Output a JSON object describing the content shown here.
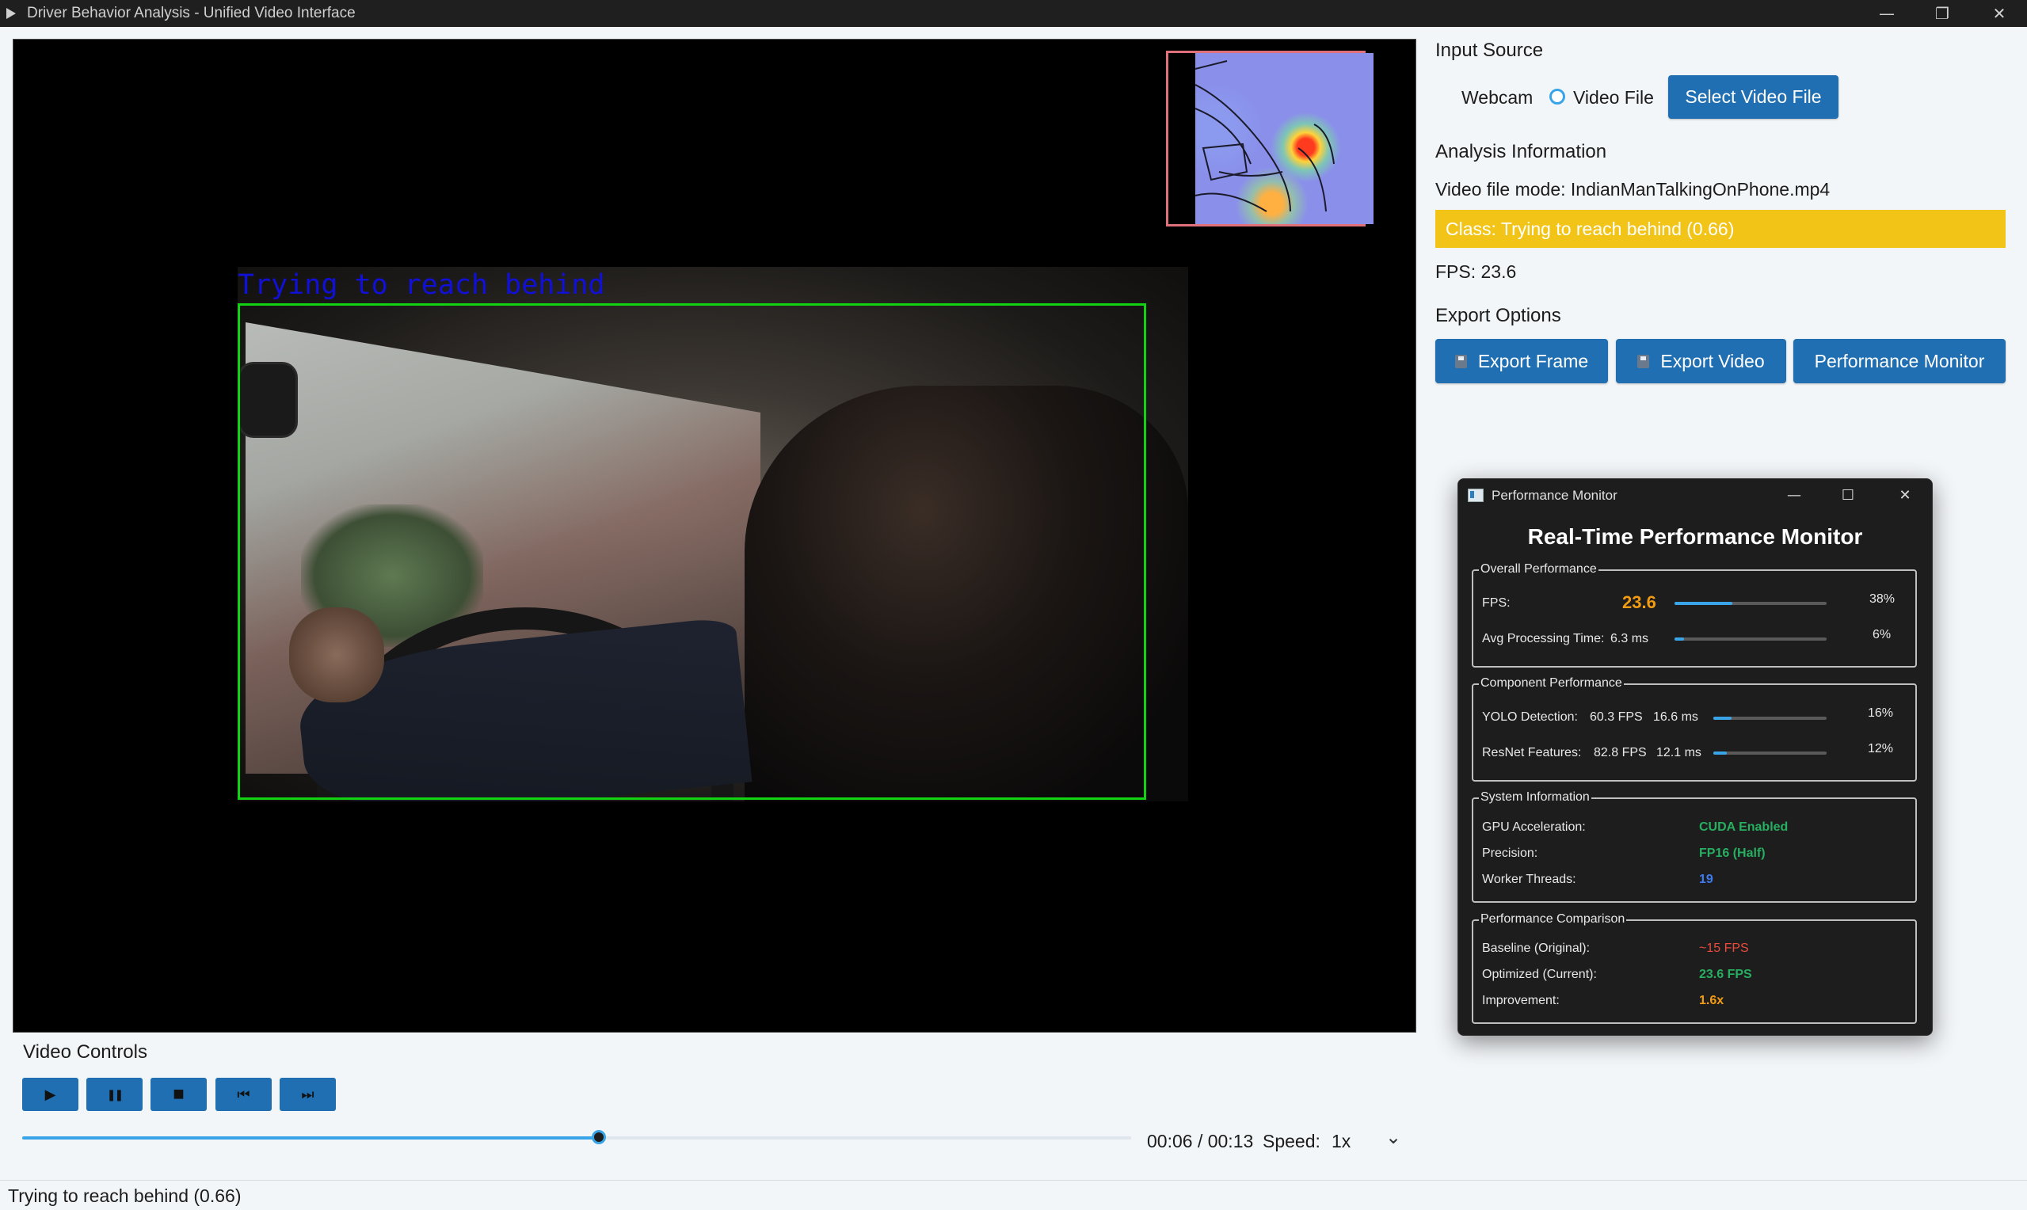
{
  "window": {
    "title": "Driver Behavior Analysis - Unified Video Interface",
    "minimize": "—",
    "restore": "❐",
    "close": "✕"
  },
  "video": {
    "detection_label": "Trying to reach behind"
  },
  "input_source": {
    "title": "Input Source",
    "options": [
      "Webcam",
      "Video File"
    ],
    "selected": "Video File",
    "select_button": "Select Video File"
  },
  "analysis": {
    "title": "Analysis Information",
    "mode": "Video file mode: IndianManTalkingOnPhone.mp4",
    "class": "Class: Trying to reach behind (0.66)",
    "class_color": "#f2c417",
    "fps": "FPS: 23.6"
  },
  "export": {
    "title": "Export Options",
    "frame_button": "Export Frame",
    "video_button": "Export Video",
    "monitor_button": "Performance Monitor",
    "accent": "#1f6fb2"
  },
  "controls": {
    "title": "Video Controls",
    "buttons": [
      {
        "name": "play",
        "icon": "▶"
      },
      {
        "name": "pause",
        "icon": "❚❚"
      },
      {
        "name": "stop",
        "icon": "■"
      },
      {
        "name": "previous",
        "icon": "⏮"
      },
      {
        "name": "next",
        "icon": "⏭"
      }
    ],
    "progress": 0.52,
    "time": "00:06 / 00:13",
    "speed_label": "Speed:",
    "speed_value": "1x",
    "dropdown_icon": "⌄"
  },
  "status": {
    "text": "Trying to reach behind (0.66)"
  },
  "perf_monitor": {
    "window_title": "Performance Monitor",
    "heading": "Real-Time Performance Monitor",
    "overall": {
      "title": "Overall Performance",
      "fps_label": "FPS:",
      "fps_value": "23.6",
      "fps_value_color": "#f39c12",
      "fps_pct": "38%",
      "fps_fraction": 0.38,
      "avg_label": "Avg Processing Time:",
      "avg_value": "6.3 ms",
      "avg_pct": "6%",
      "avg_fraction": 0.06
    },
    "components": {
      "title": "Component Performance",
      "yolo_label": "YOLO Detection:",
      "yolo_fps": "60.3 FPS",
      "yolo_ms": "16.6 ms",
      "yolo_pct": "16%",
      "yolo_fraction": 0.16,
      "resnet_label": "ResNet Features:",
      "resnet_fps": "82.8 FPS",
      "resnet_ms": "12.1 ms",
      "resnet_pct": "12%",
      "resnet_fraction": 0.12
    },
    "system": {
      "title": "System Information",
      "gpu_label": "GPU Acceleration:",
      "gpu_value": "CUDA Enabled",
      "precision_label": "Precision:",
      "precision_value": "FP16 (Half)",
      "threads_label": "Worker Threads:",
      "threads_value": "19",
      "green": "#27ae60",
      "blue": "#3d7bf0"
    },
    "comparison": {
      "title": "Performance Comparison",
      "baseline_label": "Baseline (Original):",
      "baseline_value": "~15 FPS",
      "baseline_color": "#e74c3c",
      "optimized_label": "Optimized (Current):",
      "optimized_value": "23.6 FPS",
      "improvement_label": "Improvement:",
      "improvement_value": "1.6x",
      "improvement_color": "#f39c12"
    }
  }
}
